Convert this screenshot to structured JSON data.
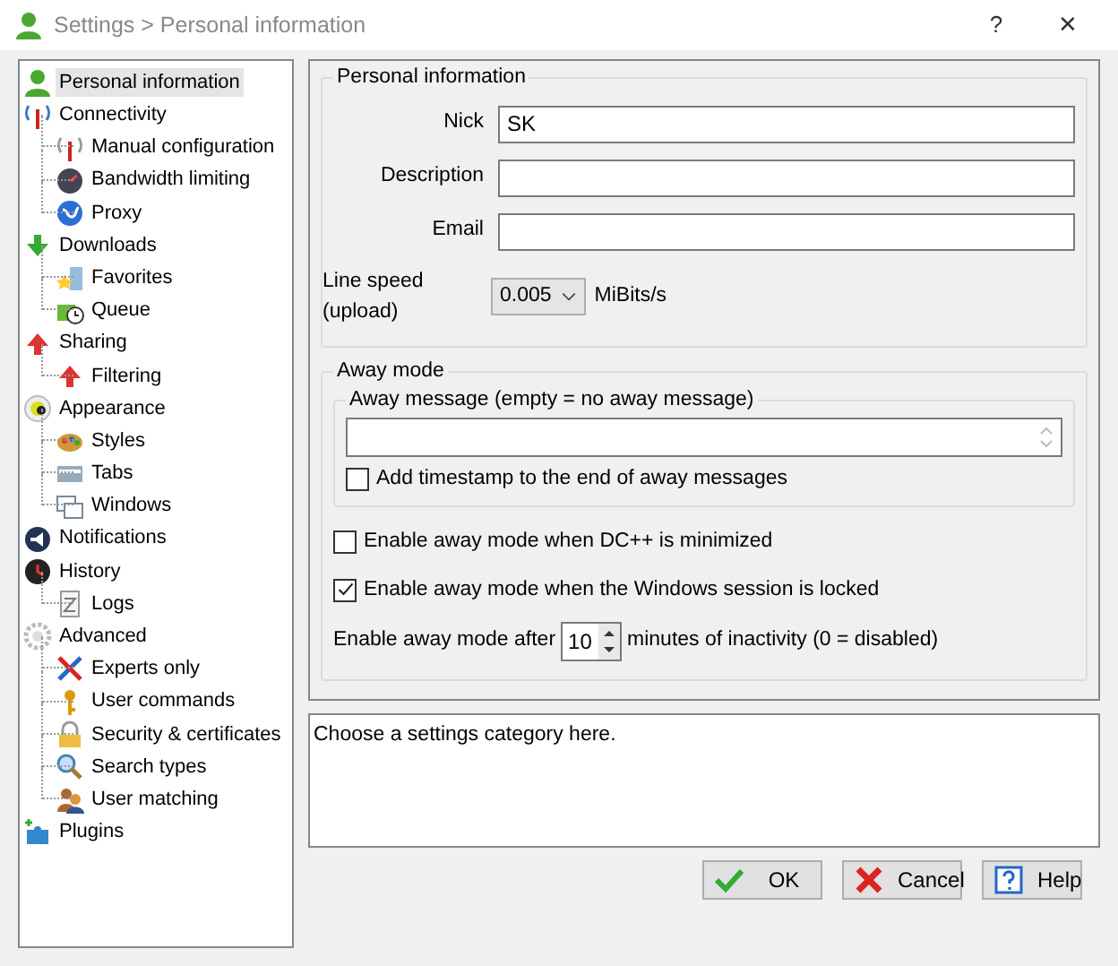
{
  "window": {
    "title": "Settings > Personal information",
    "help": "?",
    "close": "✕"
  },
  "tree": [
    {
      "label": "Personal information",
      "selected": true
    },
    {
      "label": "Connectivity",
      "selected": false,
      "children": [
        {
          "label": "Manual configuration",
          "selected": false
        },
        {
          "label": "Bandwidth limiting",
          "selected": false
        },
        {
          "label": "Proxy",
          "selected": false
        }
      ]
    },
    {
      "label": "Downloads",
      "selected": false,
      "children": [
        {
          "label": "Favorites",
          "selected": false
        },
        {
          "label": "Queue",
          "selected": false
        }
      ]
    },
    {
      "label": "Sharing",
      "selected": false,
      "children": [
        {
          "label": "Filtering",
          "selected": false
        }
      ]
    },
    {
      "label": "Appearance",
      "selected": false,
      "children": [
        {
          "label": "Styles",
          "selected": false
        },
        {
          "label": "Tabs",
          "selected": false
        },
        {
          "label": "Windows",
          "selected": false
        }
      ]
    },
    {
      "label": "Notifications",
      "selected": false
    },
    {
      "label": "History",
      "selected": false,
      "children": [
        {
          "label": "Logs",
          "selected": false
        }
      ]
    },
    {
      "label": "Advanced",
      "selected": false,
      "children": [
        {
          "label": "Experts only",
          "selected": false
        },
        {
          "label": "User commands",
          "selected": false
        },
        {
          "label": "Security & certificates",
          "selected": false
        },
        {
          "label": "Search types",
          "selected": false
        },
        {
          "label": "User matching",
          "selected": false
        }
      ]
    },
    {
      "label": "Plugins",
      "selected": false
    }
  ],
  "personal": {
    "title": "Personal information",
    "fields": [
      {
        "label": "Nick",
        "value": "SK"
      },
      {
        "label": "Description"
      },
      {
        "label": "Email"
      }
    ],
    "line_speed": {
      "label": "Line speed (upload)",
      "value": "0.005",
      "unit": "MiBits/s"
    }
  },
  "away": {
    "title": "Away mode",
    "message_group": "Away message (empty = no away message)",
    "timestamp": {
      "label": "Add timestamp to the end of away messages",
      "checked": false
    },
    "options": [
      {
        "label": "Enable away mode when DC++ is minimized",
        "checked": false
      },
      {
        "label": "Enable away mode when the Windows session is locked",
        "checked": true
      }
    ],
    "after": {
      "label": "Enable away mode after",
      "value": "10",
      "suffix": "minutes of inactivity (0 = disabled)"
    }
  },
  "description": "Choose a settings category here.",
  "buttons": [
    {
      "kind": "ok",
      "label": "OK"
    },
    {
      "kind": "cancel",
      "label": "Cancel"
    },
    {
      "kind": "help",
      "label": "Help"
    }
  ]
}
